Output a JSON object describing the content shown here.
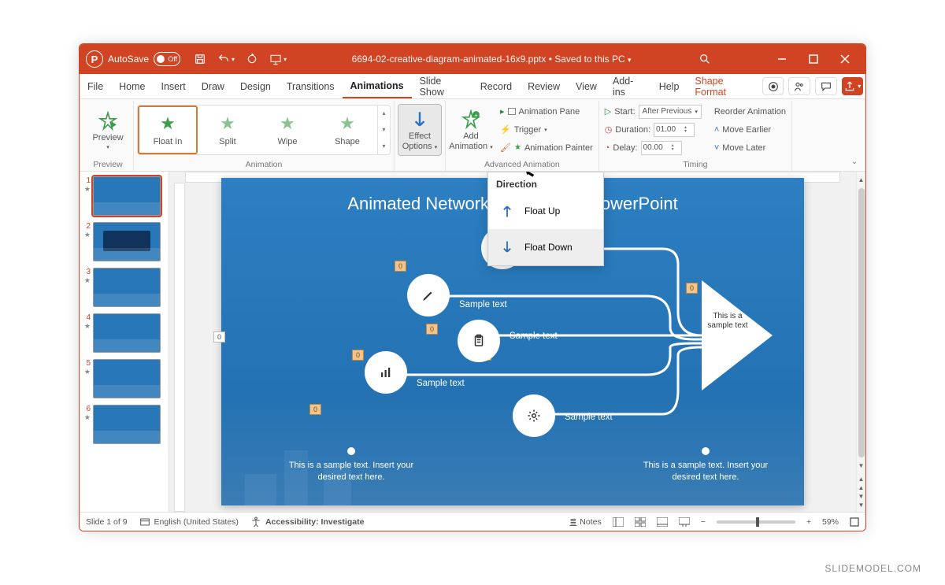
{
  "titlebar": {
    "autosave_label": "AutoSave",
    "autosave_state": "Off",
    "filename": "6694-02-creative-diagram-animated-16x9.pptx",
    "saved_status": "Saved to this PC"
  },
  "tabs": {
    "file": "File",
    "home": "Home",
    "insert": "Insert",
    "draw": "Draw",
    "design": "Design",
    "transitions": "Transitions",
    "animations": "Animations",
    "slideshow": "Slide Show",
    "record": "Record",
    "review": "Review",
    "view": "View",
    "addins": "Add-ins",
    "help": "Help",
    "shapeformat": "Shape Format"
  },
  "ribbon": {
    "preview_btn": "Preview",
    "preview_group": "Preview",
    "gallery": {
      "float_in": "Float In",
      "split": "Split",
      "wipe": "Wipe",
      "shape": "Shape"
    },
    "animation_group": "Animation",
    "effect_options": "Effect Options",
    "add_animation": "Add Animation",
    "animation_pane": "Animation Pane",
    "trigger": "Trigger",
    "animation_painter": "Animation Painter",
    "advanced_group": "Advanced Animation",
    "start_label": "Start:",
    "start_value": "After Previous",
    "duration_label": "Duration:",
    "duration_value": "01.00",
    "delay_label": "Delay:",
    "delay_value": "00.00",
    "reorder_label": "Reorder Animation",
    "move_earlier": "Move Earlier",
    "move_later": "Move Later",
    "timing_group": "Timing"
  },
  "effect_menu": {
    "header": "Direction",
    "float_up": "Float Up",
    "float_down": "Float Down"
  },
  "thumbs": {
    "numbers": [
      "1",
      "2",
      "3",
      "4",
      "5",
      "6"
    ]
  },
  "slide": {
    "title": "Animated Network Diagram for PowerPoint",
    "sample": "Sample text",
    "arrow_text": "This is a sample text",
    "blurb": "This is a sample text. Insert your desired text here.",
    "tag": "0"
  },
  "statusbar": {
    "slide_of": "Slide 1 of 9",
    "lang": "English (United States)",
    "accessibility": "Accessibility: Investigate",
    "notes": "Notes",
    "zoom": "59%"
  },
  "watermark": "SLIDEMODEL.COM"
}
